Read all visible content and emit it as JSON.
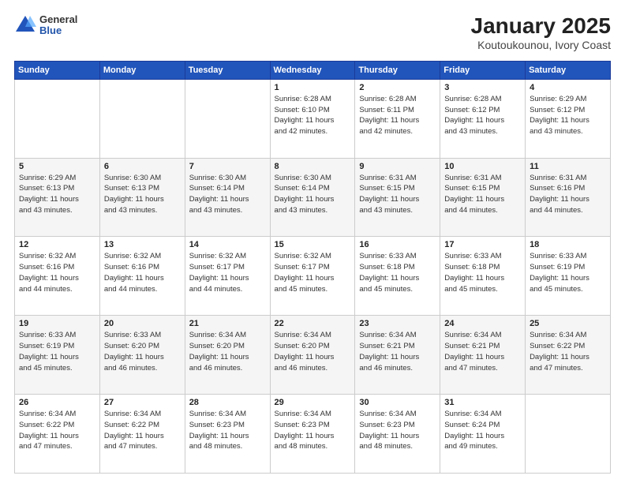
{
  "header": {
    "logo_general": "General",
    "logo_blue": "Blue",
    "title": "January 2025",
    "subtitle": "Koutoukounou, Ivory Coast"
  },
  "days_of_week": [
    "Sunday",
    "Monday",
    "Tuesday",
    "Wednesday",
    "Thursday",
    "Friday",
    "Saturday"
  ],
  "weeks": [
    [
      {
        "day": "",
        "info": ""
      },
      {
        "day": "",
        "info": ""
      },
      {
        "day": "",
        "info": ""
      },
      {
        "day": "1",
        "info": "Sunrise: 6:28 AM\nSunset: 6:10 PM\nDaylight: 11 hours\nand 42 minutes."
      },
      {
        "day": "2",
        "info": "Sunrise: 6:28 AM\nSunset: 6:11 PM\nDaylight: 11 hours\nand 42 minutes."
      },
      {
        "day": "3",
        "info": "Sunrise: 6:28 AM\nSunset: 6:12 PM\nDaylight: 11 hours\nand 43 minutes."
      },
      {
        "day": "4",
        "info": "Sunrise: 6:29 AM\nSunset: 6:12 PM\nDaylight: 11 hours\nand 43 minutes."
      }
    ],
    [
      {
        "day": "5",
        "info": "Sunrise: 6:29 AM\nSunset: 6:13 PM\nDaylight: 11 hours\nand 43 minutes."
      },
      {
        "day": "6",
        "info": "Sunrise: 6:30 AM\nSunset: 6:13 PM\nDaylight: 11 hours\nand 43 minutes."
      },
      {
        "day": "7",
        "info": "Sunrise: 6:30 AM\nSunset: 6:14 PM\nDaylight: 11 hours\nand 43 minutes."
      },
      {
        "day": "8",
        "info": "Sunrise: 6:30 AM\nSunset: 6:14 PM\nDaylight: 11 hours\nand 43 minutes."
      },
      {
        "day": "9",
        "info": "Sunrise: 6:31 AM\nSunset: 6:15 PM\nDaylight: 11 hours\nand 43 minutes."
      },
      {
        "day": "10",
        "info": "Sunrise: 6:31 AM\nSunset: 6:15 PM\nDaylight: 11 hours\nand 44 minutes."
      },
      {
        "day": "11",
        "info": "Sunrise: 6:31 AM\nSunset: 6:16 PM\nDaylight: 11 hours\nand 44 minutes."
      }
    ],
    [
      {
        "day": "12",
        "info": "Sunrise: 6:32 AM\nSunset: 6:16 PM\nDaylight: 11 hours\nand 44 minutes."
      },
      {
        "day": "13",
        "info": "Sunrise: 6:32 AM\nSunset: 6:16 PM\nDaylight: 11 hours\nand 44 minutes."
      },
      {
        "day": "14",
        "info": "Sunrise: 6:32 AM\nSunset: 6:17 PM\nDaylight: 11 hours\nand 44 minutes."
      },
      {
        "day": "15",
        "info": "Sunrise: 6:32 AM\nSunset: 6:17 PM\nDaylight: 11 hours\nand 45 minutes."
      },
      {
        "day": "16",
        "info": "Sunrise: 6:33 AM\nSunset: 6:18 PM\nDaylight: 11 hours\nand 45 minutes."
      },
      {
        "day": "17",
        "info": "Sunrise: 6:33 AM\nSunset: 6:18 PM\nDaylight: 11 hours\nand 45 minutes."
      },
      {
        "day": "18",
        "info": "Sunrise: 6:33 AM\nSunset: 6:19 PM\nDaylight: 11 hours\nand 45 minutes."
      }
    ],
    [
      {
        "day": "19",
        "info": "Sunrise: 6:33 AM\nSunset: 6:19 PM\nDaylight: 11 hours\nand 45 minutes."
      },
      {
        "day": "20",
        "info": "Sunrise: 6:33 AM\nSunset: 6:20 PM\nDaylight: 11 hours\nand 46 minutes."
      },
      {
        "day": "21",
        "info": "Sunrise: 6:34 AM\nSunset: 6:20 PM\nDaylight: 11 hours\nand 46 minutes."
      },
      {
        "day": "22",
        "info": "Sunrise: 6:34 AM\nSunset: 6:20 PM\nDaylight: 11 hours\nand 46 minutes."
      },
      {
        "day": "23",
        "info": "Sunrise: 6:34 AM\nSunset: 6:21 PM\nDaylight: 11 hours\nand 46 minutes."
      },
      {
        "day": "24",
        "info": "Sunrise: 6:34 AM\nSunset: 6:21 PM\nDaylight: 11 hours\nand 47 minutes."
      },
      {
        "day": "25",
        "info": "Sunrise: 6:34 AM\nSunset: 6:22 PM\nDaylight: 11 hours\nand 47 minutes."
      }
    ],
    [
      {
        "day": "26",
        "info": "Sunrise: 6:34 AM\nSunset: 6:22 PM\nDaylight: 11 hours\nand 47 minutes."
      },
      {
        "day": "27",
        "info": "Sunrise: 6:34 AM\nSunset: 6:22 PM\nDaylight: 11 hours\nand 47 minutes."
      },
      {
        "day": "28",
        "info": "Sunrise: 6:34 AM\nSunset: 6:23 PM\nDaylight: 11 hours\nand 48 minutes."
      },
      {
        "day": "29",
        "info": "Sunrise: 6:34 AM\nSunset: 6:23 PM\nDaylight: 11 hours\nand 48 minutes."
      },
      {
        "day": "30",
        "info": "Sunrise: 6:34 AM\nSunset: 6:23 PM\nDaylight: 11 hours\nand 48 minutes."
      },
      {
        "day": "31",
        "info": "Sunrise: 6:34 AM\nSunset: 6:24 PM\nDaylight: 11 hours\nand 49 minutes."
      },
      {
        "day": "",
        "info": ""
      }
    ]
  ]
}
